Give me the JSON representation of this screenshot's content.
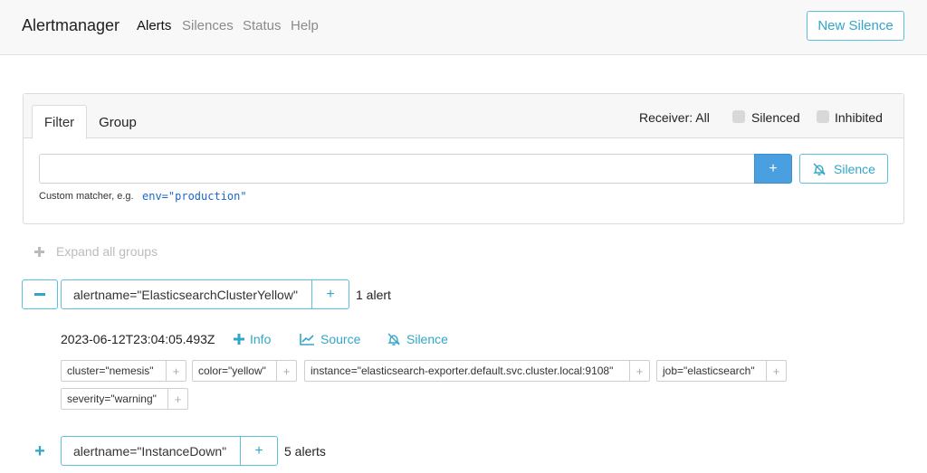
{
  "navbar": {
    "brand": "Alertmanager",
    "links": [
      "Alerts",
      "Silences",
      "Status",
      "Help"
    ],
    "new_silence": "New Silence"
  },
  "filter": {
    "tabs": [
      "Filter",
      "Group"
    ],
    "receiver": "Receiver: All",
    "silenced_label": "Silenced",
    "inhibited_label": "Inhibited",
    "input_value": "",
    "add_label": "+",
    "silence_label": "Silence",
    "hint_text": "Custom matcher, e.g.",
    "hint_example": "env=\"production\""
  },
  "expand_all": "Expand all groups",
  "groups": [
    {
      "label": "alertname=\"ElasticsearchClusterYellow\"",
      "count": "1 alert",
      "expanded": true,
      "alert": {
        "timestamp": "2023-06-12T23:04:05.493Z",
        "actions": [
          "Info",
          "Source",
          "Silence"
        ],
        "labels": [
          "cluster=\"nemesis\"",
          "color=\"yellow\"",
          "instance=\"elasticsearch-exporter.default.svc.cluster.local:9108\"",
          "job=\"elasticsearch\"",
          "severity=\"warning\""
        ]
      }
    },
    {
      "label": "alertname=\"InstanceDown\"",
      "count": "5 alerts",
      "expanded": false
    }
  ],
  "colors": {
    "accent": "#31a6c7",
    "accent_border": "#5bc0de",
    "primary": "#4a9fe0"
  },
  "icons": {
    "plus": "plus-icon",
    "minus": "minus-icon",
    "silence": "bell-slash-icon",
    "source": "chart-line-icon",
    "info": "plus-icon"
  }
}
